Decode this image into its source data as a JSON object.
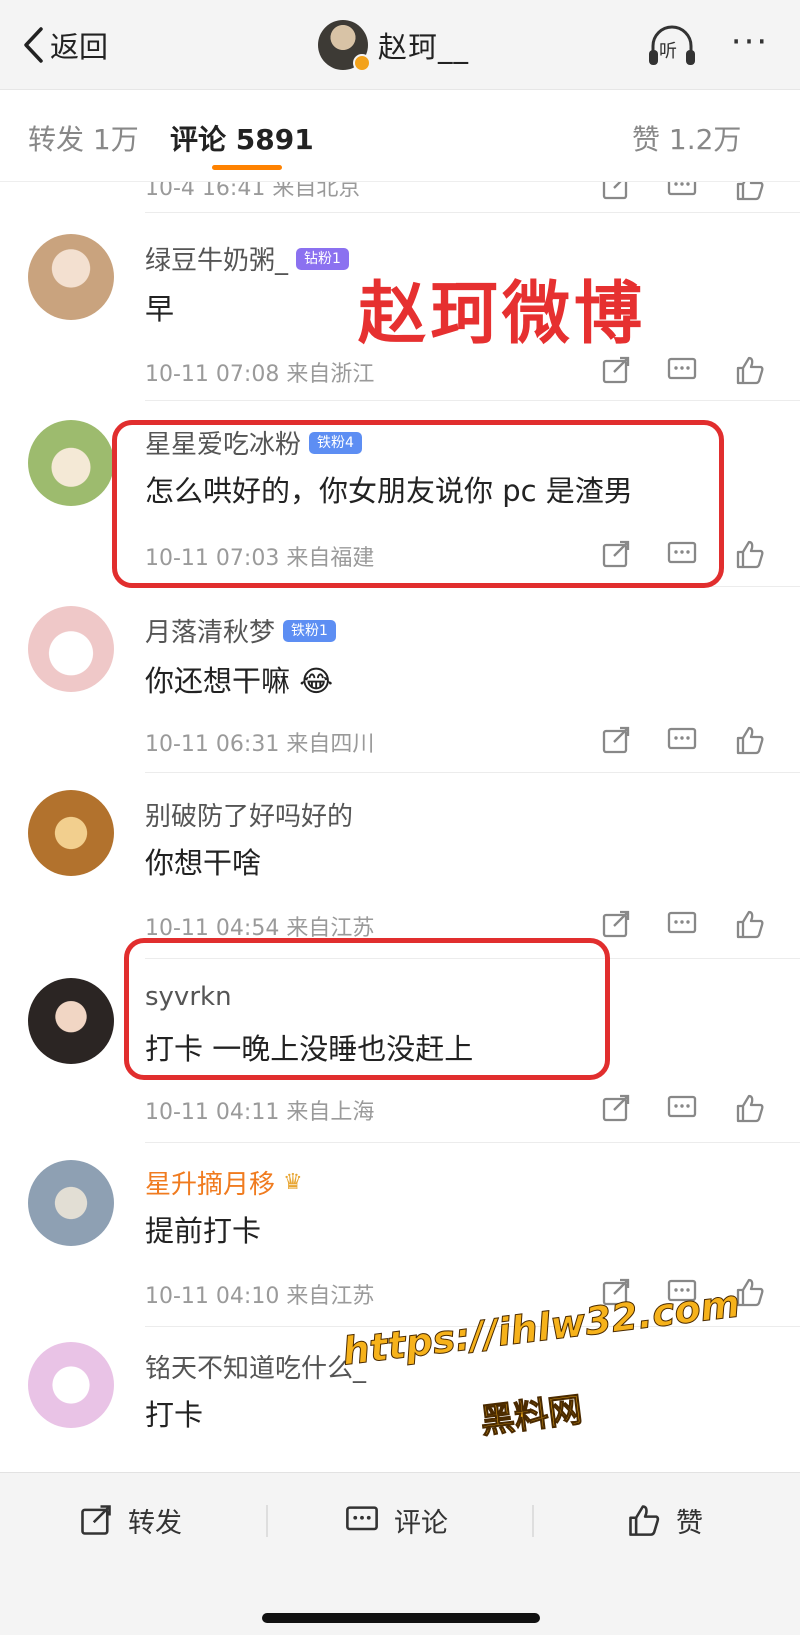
{
  "header": {
    "back_label": "返回",
    "title": "赵珂__",
    "listen_label": "听",
    "more_label": "···"
  },
  "tabs": {
    "repost": "转发 1万",
    "comments_label": "评论",
    "comments_count": "5891",
    "likes": "赞 1.2万"
  },
  "partial_meta": "10-4 16:41 来自北京",
  "comments": [
    {
      "name": "绿豆牛奶粥_",
      "badge": "钻粉1",
      "text": "早",
      "meta": "10-11 07:08 来自浙江",
      "avatar_color": "#c9a37e"
    },
    {
      "name": "星星爱吃冰粉",
      "badge": "铁粉4",
      "text": "怎么哄好的，你女朋友说你 pc 是渣男",
      "meta": "10-11 07:03 来自福建",
      "avatar_color": "#9dbb6e"
    },
    {
      "name": "月落清秋梦",
      "badge": "铁粉1",
      "text": "你还想干嘛 😂",
      "meta": "10-11 06:31 来自四川",
      "avatar_color": "#efc8c8"
    },
    {
      "name": "别破防了好吗好的",
      "badge": "",
      "text": "你想干啥",
      "meta": "10-11 04:54 来自江苏",
      "avatar_color": "#b2722d"
    },
    {
      "name": "syvrkn",
      "badge": "",
      "text": "打卡 一晚上没睡也没赶上",
      "meta": "10-11 04:11 来自上海",
      "avatar_color": "#2b2523"
    },
    {
      "name": "星升摘月移",
      "badge": "",
      "text": "提前打卡",
      "meta": "10-11 04:10 来自江苏",
      "avatar_color": "#8ea0b3"
    },
    {
      "name": "铭天不知道吃什么_",
      "badge": "",
      "text": "打卡",
      "meta": "",
      "avatar_color": "#e9c3e6"
    }
  ],
  "overlay": {
    "title": "赵珂微博",
    "url": "https://ihlw32.com",
    "site": "黑料网"
  },
  "bottom": {
    "repost": "转发",
    "comment": "评论",
    "like": "赞"
  },
  "colors": {
    "accent": "#ff8200",
    "annotation": "#e12e2e",
    "watermark": "#f6b21b"
  }
}
